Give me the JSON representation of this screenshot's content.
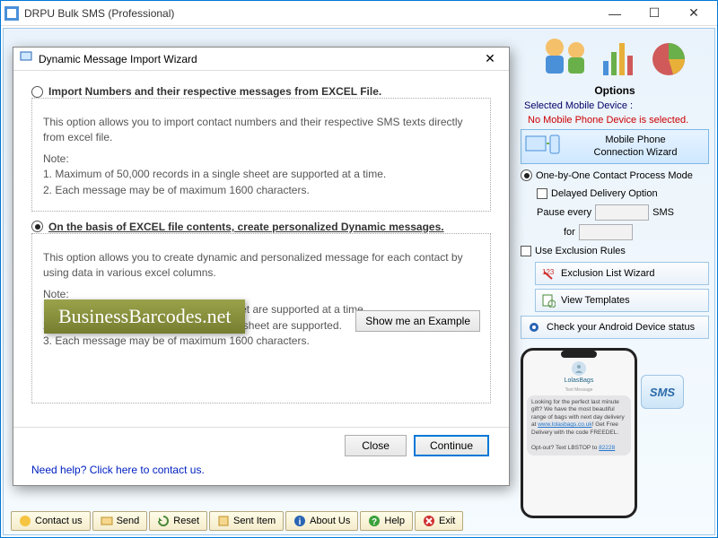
{
  "main": {
    "title": "DRPU Bulk SMS (Professional)"
  },
  "dialog": {
    "title": "Dynamic Message Import Wizard",
    "option1": {
      "label": "Import Numbers and their respective messages from EXCEL File.",
      "desc": "This option allows you to import contact numbers and their respective SMS texts directly from excel file.",
      "note_label": "Note:",
      "note1": "1. Maximum of 50,000 records in a single sheet are supported at a time.",
      "note2": "2. Each message may be of maximum 1600 characters."
    },
    "option2": {
      "label": "On the basis of EXCEL file contents, create personalized Dynamic messages.",
      "desc": "This option allows you to create dynamic and personalized message for each contact by using data in various excel columns.",
      "note_label": "Note:",
      "note1": "1. Maximum of 10 Column in a single sheet are supported at a time.",
      "note2": "2. Maximum of 50,000 records in a single sheet are supported.",
      "note3": "3. Each message may be of maximum 1600 characters."
    },
    "watermark": "BusinessBarcodes.net",
    "example_btn": "Show me an Example",
    "close_btn": "Close",
    "continue_btn": "Continue",
    "help_link": "Need help? Click here to contact us."
  },
  "options": {
    "title": "Options",
    "selected_label": "Selected Mobile Device :",
    "no_device": "No Mobile Phone Device is selected.",
    "wizard_line1": "Mobile Phone",
    "wizard_line2": "Connection  Wizard",
    "mode_label": "One-by-One Contact Process Mode",
    "delayed_label": "Delayed Delivery Option",
    "pause_label": "Pause every",
    "sms_label": "SMS",
    "for_label": "for",
    "exclusion_check": "Use Exclusion Rules",
    "exclusion_btn": "Exclusion List Wizard",
    "templates_btn": "View Templates",
    "android_btn": "Check your Android Device status"
  },
  "phone": {
    "contact_name": "LolasBags",
    "header": "Text Message",
    "msg_text": "Looking for the perfect last minute gift? We have the most beautiful range of bags with next day delivery at ",
    "link1": "www.lolasbags.co.uk",
    "msg_text2": "! Get Free Delivery with the code FREEDEL.",
    "optout": "Opt-out? Text LBSTOP to ",
    "optout_num": "82228"
  },
  "sms_badge": "SMS",
  "toolbar": {
    "contact": "Contact us",
    "send": "Send",
    "reset": "Reset",
    "sent": "Sent Item",
    "about": "About Us",
    "help": "Help",
    "exit": "Exit"
  }
}
